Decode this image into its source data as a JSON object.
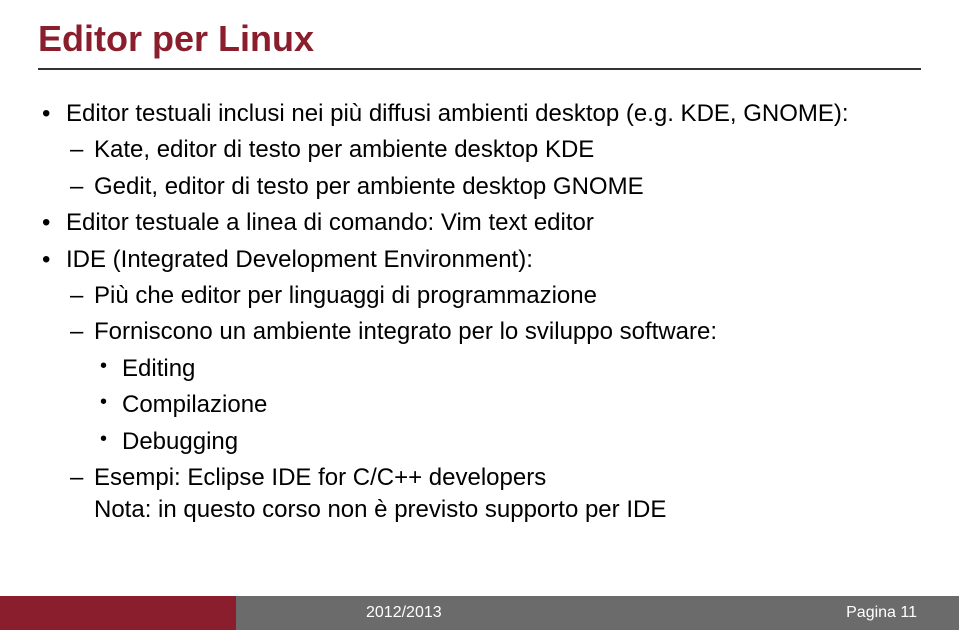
{
  "title": "Editor per Linux",
  "bullets": {
    "b1": "Editor testuali inclusi nei più diffusi ambienti desktop (e.g. KDE, GNOME):",
    "b1_1": "Kate, editor di testo per ambiente desktop KDE",
    "b1_2": "Gedit, editor di testo per ambiente  desktop GNOME",
    "b2": "Editor testuale a linea di comando: Vim text editor",
    "b3": "IDE (Integrated Development Environment):",
    "b3_1": "Più che editor per linguaggi di programmazione",
    "b3_2": "Forniscono un ambiente integrato per lo sviluppo software:",
    "b3_2_1": "Editing",
    "b3_2_2": "Compilazione",
    "b3_2_3": "Debugging",
    "b3_3": "Esempi: Eclipse IDE for C/C++ developers",
    "b3_note": "Nota: in questo corso non è previsto supporto per IDE"
  },
  "footer": {
    "year": "2012/2013",
    "page": "Pagina 11"
  }
}
